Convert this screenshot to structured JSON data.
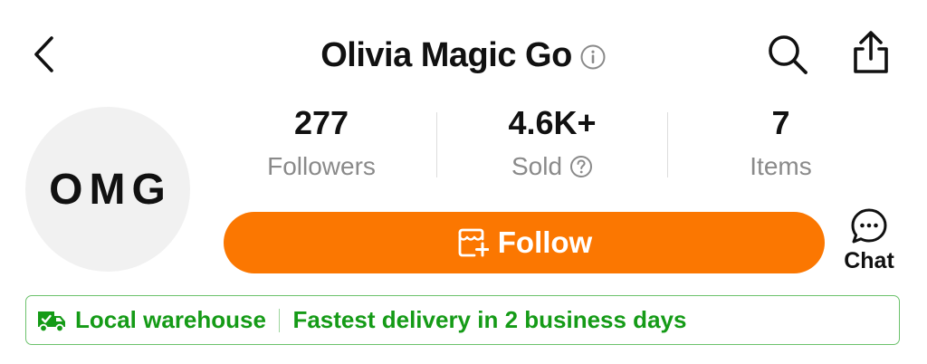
{
  "header": {
    "title": "Olivia Magic Go",
    "icons": {
      "back": "chevron-left-icon",
      "info": "info-icon",
      "search": "search-icon",
      "share": "share-icon"
    }
  },
  "avatar": {
    "text": "OMG"
  },
  "stats": {
    "followers": {
      "value": "277",
      "label": "Followers"
    },
    "sold": {
      "value": "4.6K+",
      "label": "Sold"
    },
    "items": {
      "value": "7",
      "label": "Items"
    }
  },
  "actions": {
    "follow_label": "Follow",
    "chat_label": "Chat"
  },
  "banner": {
    "title": "Local warehouse",
    "text": "Fastest delivery in 2 business days"
  },
  "colors": {
    "accent": "#fb7701",
    "banner_green": "#159b17",
    "banner_border": "#6cc26c",
    "muted_text": "#8a8a8a"
  }
}
